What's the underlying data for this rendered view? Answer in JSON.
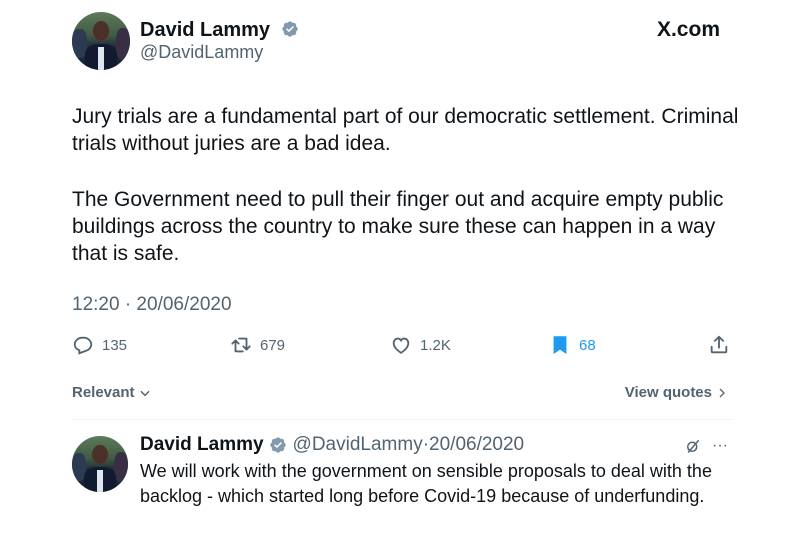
{
  "source_label": "X.com",
  "tweet": {
    "author_name": "David Lammy",
    "author_handle": "@DavidLammy",
    "paragraph_1": "Jury trials are a fundamental part of our democratic settlement. Criminal trials without juries are a bad idea.",
    "paragraph_2": "The Government need to pull their finger out and acquire empty public buildings across the country to make sure these can happen in a way that is safe.",
    "timestamp": "12:20 · 20/06/2020",
    "stats": {
      "replies": "135",
      "retweets": "679",
      "likes": "1.2K",
      "bookmarks": "68"
    }
  },
  "sort": {
    "label": "Relevant",
    "view_quotes": "View quotes"
  },
  "reply": {
    "author_name": "David Lammy",
    "author_handle": "@DavidLammy",
    "separator": " · ",
    "date": "20/06/2020",
    "more": "···",
    "text": "We will work with the government on sensible proposals to deal with the backlog - which started long before Covid-19 because of underfunding."
  },
  "colors": {
    "text": "#0f1419",
    "secondary": "#536471",
    "accent": "#1d9bf0",
    "divider": "#eff3f4"
  },
  "icons": [
    "verified-badge-icon",
    "reply-icon",
    "retweet-icon",
    "like-icon",
    "bookmark-icon",
    "share-icon",
    "chevron-down-icon",
    "chevron-right-icon",
    "grok-icon",
    "more-icon"
  ]
}
